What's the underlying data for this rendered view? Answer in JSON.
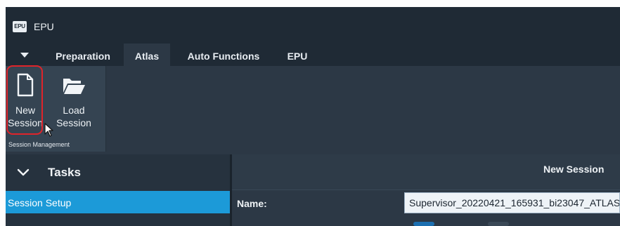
{
  "app": {
    "logo_text": "EPU",
    "title": "EPU"
  },
  "tabs": [
    {
      "label": "Preparation",
      "active": false
    },
    {
      "label": "Atlas",
      "active": true
    },
    {
      "label": "Auto Functions",
      "active": false
    },
    {
      "label": "EPU",
      "active": false
    }
  ],
  "ribbon": {
    "new_session": {
      "label": "New\nSession",
      "icon": "document-icon"
    },
    "load_session": {
      "label": "Load\nSession",
      "icon": "folder-open-icon"
    },
    "group_label": "Session Management"
  },
  "tasks": {
    "title": "Tasks",
    "items": [
      {
        "label": "Session Setup",
        "selected": true
      }
    ]
  },
  "session_form": {
    "header": "New Session",
    "name_label": "Name:",
    "name_value": "Supervisor_20220421_165931_bi23047_ATLAS"
  },
  "colors": {
    "accent": "#1c9ad8",
    "highlight": "#e0242a",
    "background": "#2c3845"
  }
}
